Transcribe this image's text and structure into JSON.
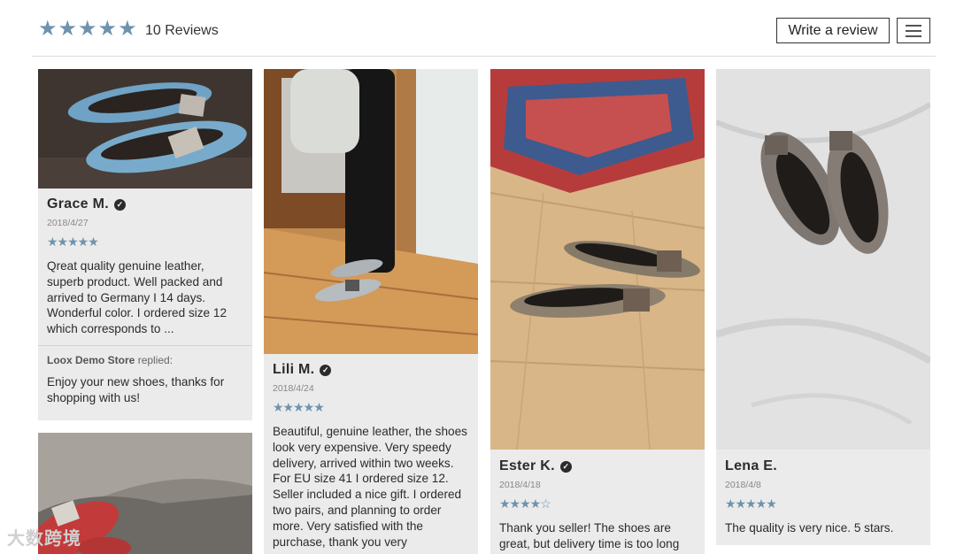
{
  "header": {
    "stars": "★★★★★",
    "review_count": "10 Reviews",
    "write_review_label": "Write a review",
    "menu_icon": "hamburger-menu-icon"
  },
  "reviews": [
    {
      "name": "Grace M.",
      "date": "2018/4/27",
      "stars": "★★★★★",
      "text": "Qreat quality genuine leather, superb product. Well packed and arrived to Germany I  14 days. Wonderful color. I ordered size 12 which corresponds to ...",
      "reply_from": "Loox Demo Store",
      "reply_suffix": " replied:",
      "reply_text": "Enjoy your new shoes, thanks for shopping with us!"
    },
    {
      "name": "Lili M.",
      "date": "2018/4/24",
      "stars": "★★★★★",
      "text": "Beautiful, genuine leather, the shoes look very expensive. Very speedy delivery, arrived within two weeks. For EU size 41 I ordered size 12. Seller included a nice gift. I ordered two pairs, and planning to order more. Very satisfied with the purchase, thank you very"
    },
    {
      "name": "Ester K.",
      "date": "2018/4/18",
      "stars": "★★★★☆",
      "text": "Thank you seller! The shoes are great, but delivery time is too long"
    },
    {
      "name": "Lena E.",
      "date": "2018/4/8",
      "stars": "★★★★★",
      "text": "The quality is very nice. 5 stars."
    }
  ],
  "watermark": "大数跨境",
  "colors": {
    "accent": "#6f93ad",
    "card_bg": "#ebebeb",
    "divider": "#dedede"
  }
}
